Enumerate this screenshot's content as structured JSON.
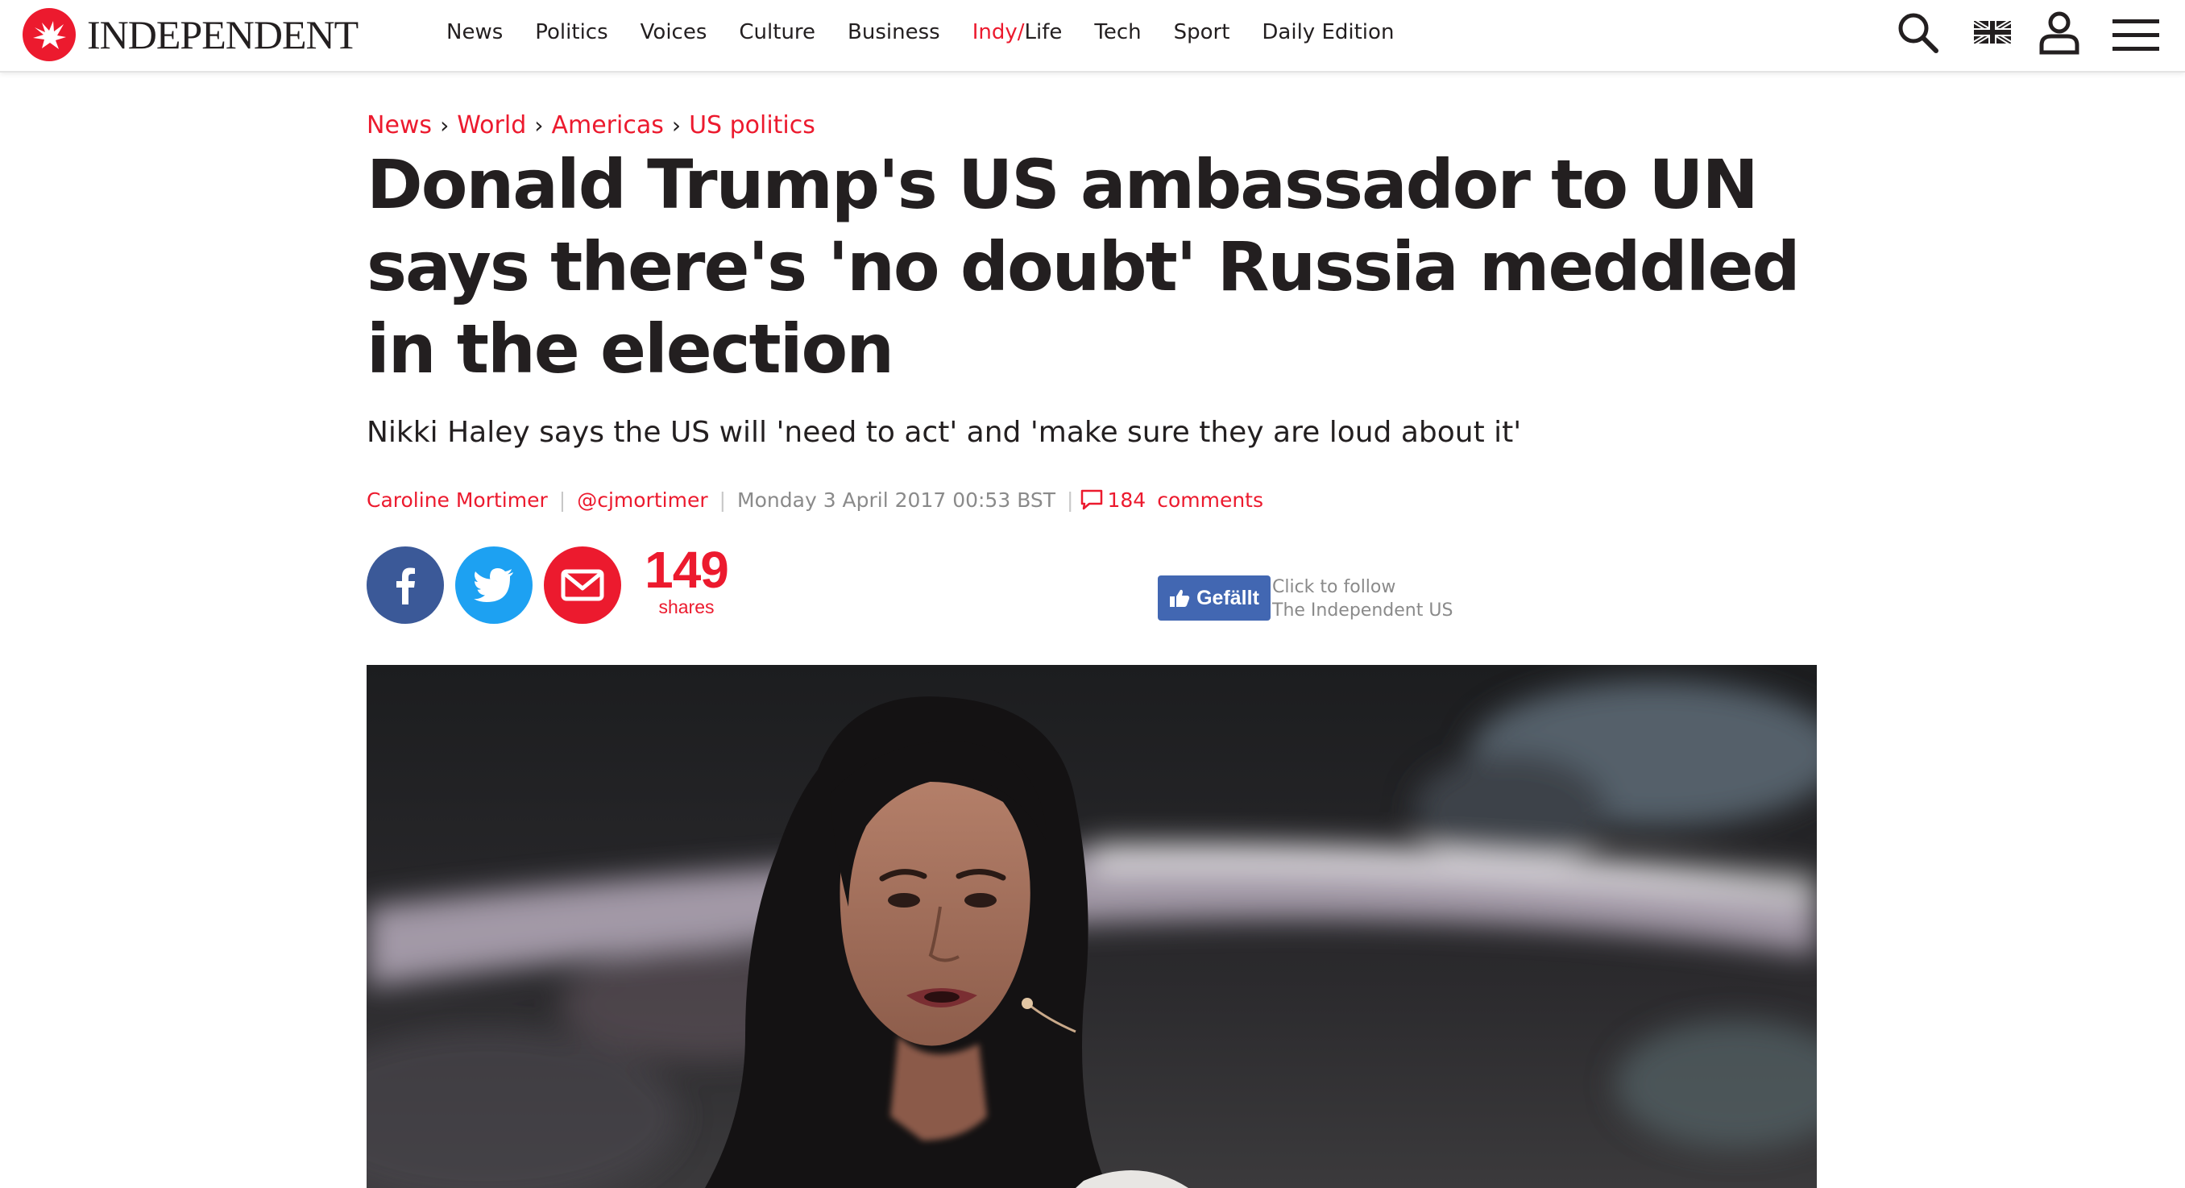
{
  "site": {
    "logo_text": "INDEPENDENT",
    "brand_color": "#ec1a2e"
  },
  "nav": {
    "items": [
      {
        "label": "News"
      },
      {
        "label": "Politics"
      },
      {
        "label": "Voices"
      },
      {
        "label": "Culture"
      },
      {
        "label": "Business"
      },
      {
        "label_red": "Indy/",
        "label_rest": "Life"
      },
      {
        "label": "Tech"
      },
      {
        "label": "Sport"
      },
      {
        "label": "Daily Edition"
      }
    ],
    "tools": [
      "search-icon",
      "uk-flag-icon",
      "user-icon",
      "menu-icon"
    ]
  },
  "article": {
    "breadcrumb": [
      "News",
      "World",
      "Americas",
      "US politics"
    ],
    "breadcrumb_separator": "›",
    "headline": "Donald Trump's US ambassador to UN says there's 'no doubt' Russia meddled in the election",
    "standfirst": "Nikki Haley says the US will 'need to act' and 'make sure they are loud about it'",
    "author": "Caroline Mortimer",
    "twitter_handle": "@cjmortimer",
    "date": "Monday 3 April 2017 00:53 BST",
    "comments_count": "184",
    "comments_label": "comments"
  },
  "share": {
    "count": "149",
    "count_label": "shares",
    "facebook_color": "#3b5998",
    "twitter_color": "#1da1f2",
    "email_color": "#ec1a2e"
  },
  "follow": {
    "like_label": "Gefällt",
    "line1": "Click to follow",
    "line2": "The Independent US",
    "like_color": "#4267b2"
  }
}
